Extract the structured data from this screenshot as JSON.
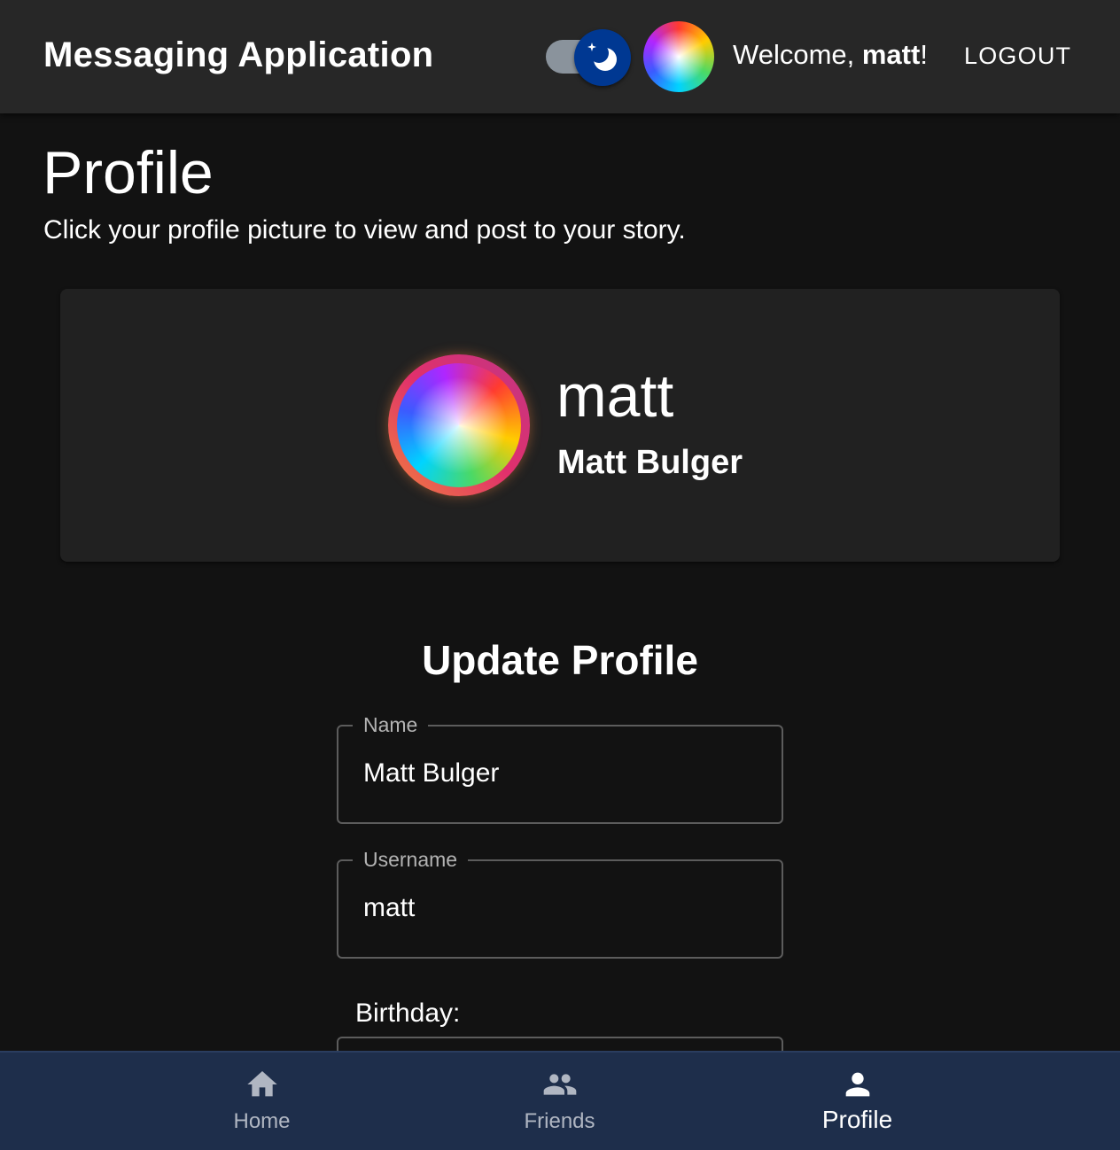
{
  "header": {
    "app_title": "Messaging Application",
    "welcome_prefix": "Welcome, ",
    "welcome_user": "matt",
    "welcome_suffix": "!",
    "logout_label": "LOGOUT",
    "theme_mode": "dark"
  },
  "page": {
    "title": "Profile",
    "subtitle": "Click your profile picture to view and post to your story."
  },
  "profile_card": {
    "username": "matt",
    "full_name": "Matt Bulger"
  },
  "update_form": {
    "title": "Update Profile",
    "name_label": "Name",
    "name_value": "Matt Bulger",
    "username_label": "Username",
    "username_value": "matt",
    "birthday_label": "Birthday:"
  },
  "bottom_nav": {
    "items": [
      {
        "label": "Home",
        "icon": "home-icon"
      },
      {
        "label": "Friends",
        "icon": "friends-icon"
      },
      {
        "label": "Profile",
        "icon": "person-icon",
        "active": true
      }
    ]
  },
  "colors": {
    "background": "#121212",
    "appbar": "#272727",
    "card": "#212121",
    "bottom_nav": "#1e2e4b",
    "toggle_thumb": "#003892"
  }
}
